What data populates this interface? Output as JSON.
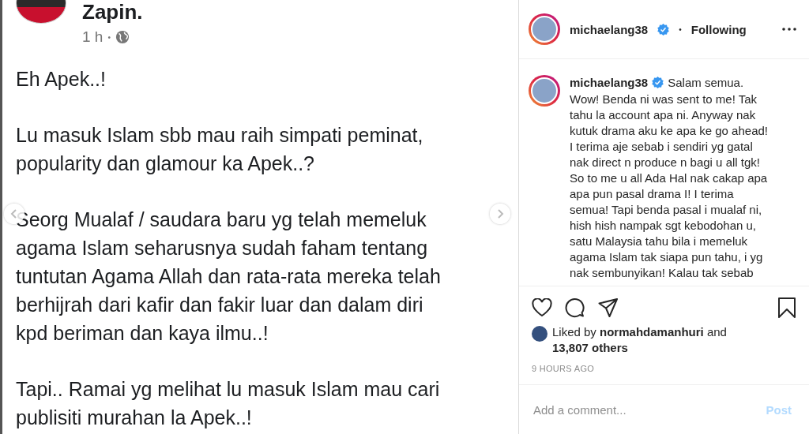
{
  "post_image": {
    "author": "Zapin.",
    "time": "1 h",
    "separator": "•",
    "paragraphs": [
      [
        "Eh Apek..!"
      ],
      [
        "Lu masuk Islam sbb mau raih simpati peminat,",
        "popularity dan glamour ka Apek..?"
      ],
      [
        "Seorg Mualaf / saudara baru yg telah memeluk",
        "agama Islam seharusnya sudah faham tentang",
        "tuntutan Agama Allah dan rata-rata mereka telah",
        "berhijrah dari kafir dan fakir luar dan dalam diri",
        "kpd beriman dan kaya ilmu..!"
      ],
      [
        "Tapi.. Ramai yg melihat lu masuk Islam mau cari",
        "publisiti murahan la Apek..!"
      ]
    ]
  },
  "header": {
    "username": "michaelang38",
    "verified": true,
    "separator": "•",
    "follow_status": "Following"
  },
  "caption": {
    "username": "michaelang38",
    "verified": true,
    "lines": [
      "Salam semua.",
      "Wow! Benda ni was sent to me! Tak",
      "tahu la account apa ni. Anyway nak",
      "kutuk drama aku ke apa ke go ahead!",
      "I terima aje sebab i sendiri yg gatal",
      "nak direct n produce n bagi u all tgk!",
      "So to me u all Ada Hal nak cakap apa",
      "apa pun pasal drama I! I terima",
      "semua! Tapi benda pasal i mualaf ni,",
      "hish hish nampak sgt kebodohan u,",
      "satu Malaysia tahu bila i memeluk",
      "agama Islam tak siapa pun tahu, i yg",
      "nak sembunyikan! Kalau tak sebab"
    ]
  },
  "likes": {
    "lines": [
      "Liked by **normahdamanhuri** and",
      "**13,807 others**"
    ]
  },
  "timestamp": "9 HOURS AGO",
  "comment": {
    "placeholder": "Add a comment...",
    "post_button": "Post",
    "post_disabled": true
  }
}
